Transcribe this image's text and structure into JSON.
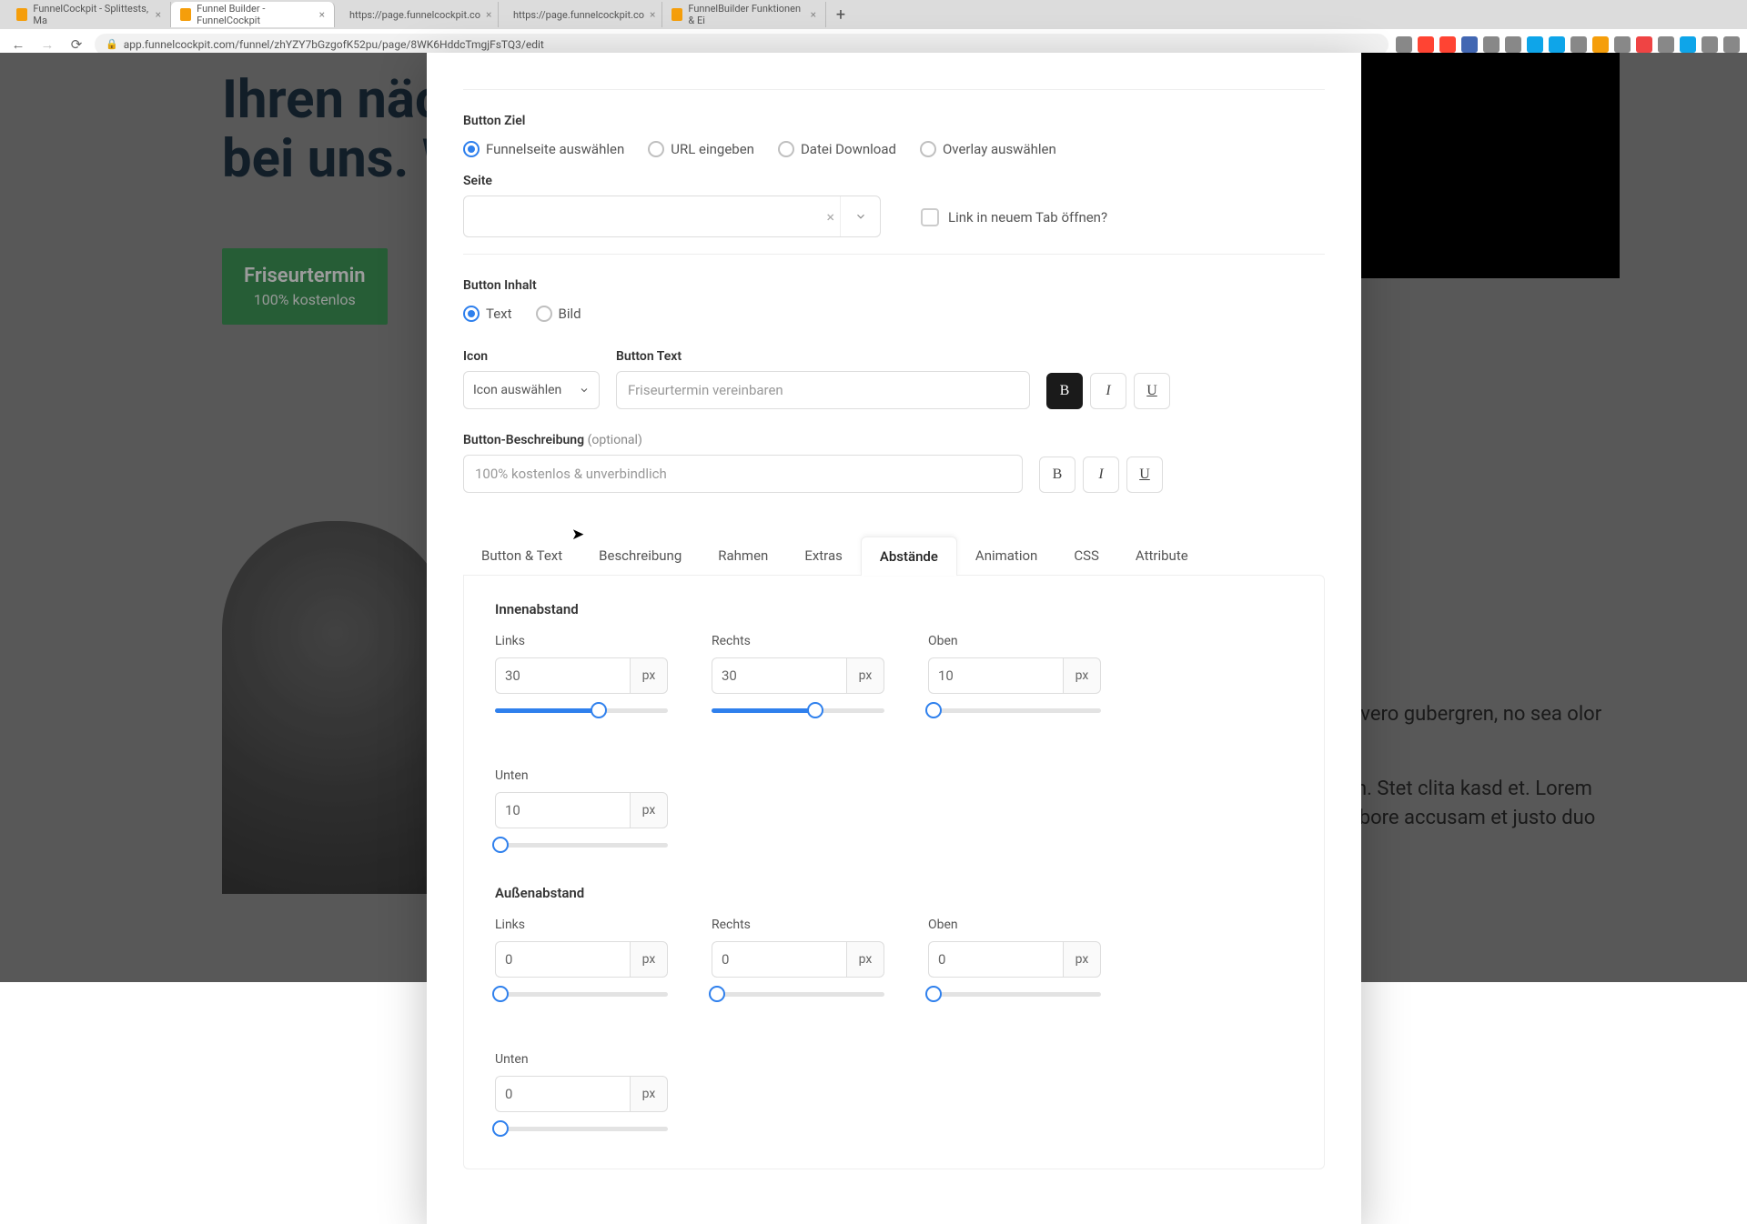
{
  "browser": {
    "tabs": [
      {
        "label": "FunnelCockpit - Splittests, Ma",
        "active": false
      },
      {
        "label": "Funnel Builder - FunnelCockpit",
        "active": true
      },
      {
        "label": "https://page.funnelcockpit.co",
        "active": false
      },
      {
        "label": "https://page.funnelcockpit.co",
        "active": false
      },
      {
        "label": "FunnelBuilder Funktionen & Ei",
        "active": false
      }
    ],
    "url": "app.funnelcockpit.com/funnel/zhYZY7bGzgofK52pu/page/8WK6HddcTmgjFsTQ3/edit"
  },
  "hero": {
    "line1": "Ihren näch",
    "line2": "bei uns. W",
    "cta_main": "Friseurtermin",
    "cta_sub": "100% kostenlos"
  },
  "lorem": {
    "p1": "nonumy eirmod m voluptua. At vero gubergren, no sea olor sit amet,",
    "p2": "gna aliquyam erat, sed m rebum. Stet clita kasd et. Lorem ipsum dolor mpor invidunt ut labore accusam et justo duo anctus est Lorem"
  },
  "modal": {
    "button_ziel": {
      "title": "Button Ziel",
      "opt1": "Funnelseite auswählen",
      "opt2": "URL eingeben",
      "opt3": "Datei Download",
      "opt4": "Overlay auswählen"
    },
    "seite": {
      "label": "Seite",
      "new_tab": "Link in neuem Tab öffnen?"
    },
    "button_inhalt": {
      "title": "Button Inhalt",
      "opt1": "Text",
      "opt2": "Bild"
    },
    "icon_sel": {
      "label": "Icon",
      "placeholder": "Icon auswählen"
    },
    "btn_text": {
      "label": "Button Text",
      "value": "Friseurtermin vereinbaren"
    },
    "btn_desc": {
      "label": "Button-Beschreibung",
      "opt": "(optional)",
      "value": "100% kostenlos & unverbindlich"
    },
    "tabs": [
      "Button & Text",
      "Beschreibung",
      "Rahmen",
      "Extras",
      "Abstände",
      "Animation",
      "CSS",
      "Attribute"
    ],
    "active_tab": "Abstände",
    "padding": {
      "title": "Innenabstand",
      "links": "Links",
      "rechts": "Rechts",
      "oben": "Oben",
      "unten": "Unten",
      "vl": "30",
      "vr": "30",
      "vo": "10",
      "vu": "10",
      "unit": "px"
    },
    "margin": {
      "title": "Außenabstand",
      "links": "Links",
      "rechts": "Rechts",
      "oben": "Oben",
      "unten": "Unten",
      "vl": "0",
      "vr": "0",
      "vo": "0",
      "vu": "0",
      "unit": "px"
    }
  },
  "ext_colors": [
    "#888",
    "#f43",
    "#f43",
    "#4267b2",
    "#888",
    "#888",
    "#0ea5e9",
    "#0ea5e9",
    "#888",
    "#f59e0b",
    "#888",
    "#ef4444",
    "#888",
    "#0ea5e9",
    "#888",
    "#888"
  ]
}
